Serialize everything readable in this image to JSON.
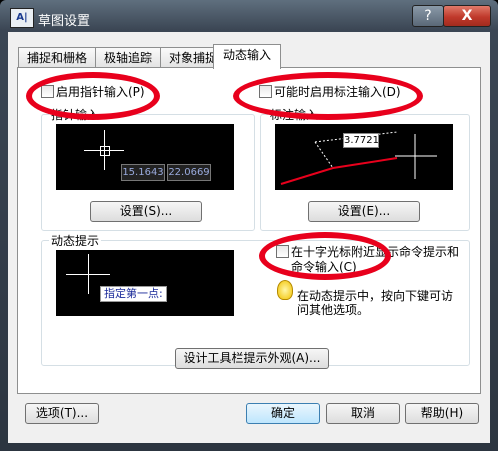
{
  "window": {
    "title": "草图设置",
    "app_icon_text": "A|"
  },
  "title_buttons": {
    "help": "?",
    "close": "X"
  },
  "tabs": [
    {
      "label": "捕捉和栅格"
    },
    {
      "label": "极轴追踪"
    },
    {
      "label": "对象捕捉"
    },
    {
      "label": "动态输入"
    }
  ],
  "pointer_input": {
    "checkbox_label": "启用指针输入(P)",
    "group_title": "指针输入",
    "coord_x": "15.1643",
    "coord_y": "22.0669",
    "settings_button": "设置(S)..."
  },
  "dimension_input": {
    "checkbox_label": "可能时启用标注输入(D)",
    "group_title": "标注输入",
    "dim_value": "3.7721",
    "settings_button": "设置(E)..."
  },
  "dynamic_prompts": {
    "group_title": "动态提示",
    "prompt_text": "指定第一点:",
    "checkbox_label_line1": "在十字光标附近显示命令提示和",
    "checkbox_label_line2": "命令输入(C)",
    "hint_line1": "在动态提示中，按向下键可访",
    "hint_line2": "问其他选项。"
  },
  "tooltip_button": "设计工具栏提示外观(A)...",
  "footer": {
    "options": "选项(T)...",
    "ok": "确定",
    "cancel": "取消",
    "help": "帮助(H)"
  },
  "colors": {
    "annotation": "#e8001c",
    "preview_bg": "#000000"
  }
}
